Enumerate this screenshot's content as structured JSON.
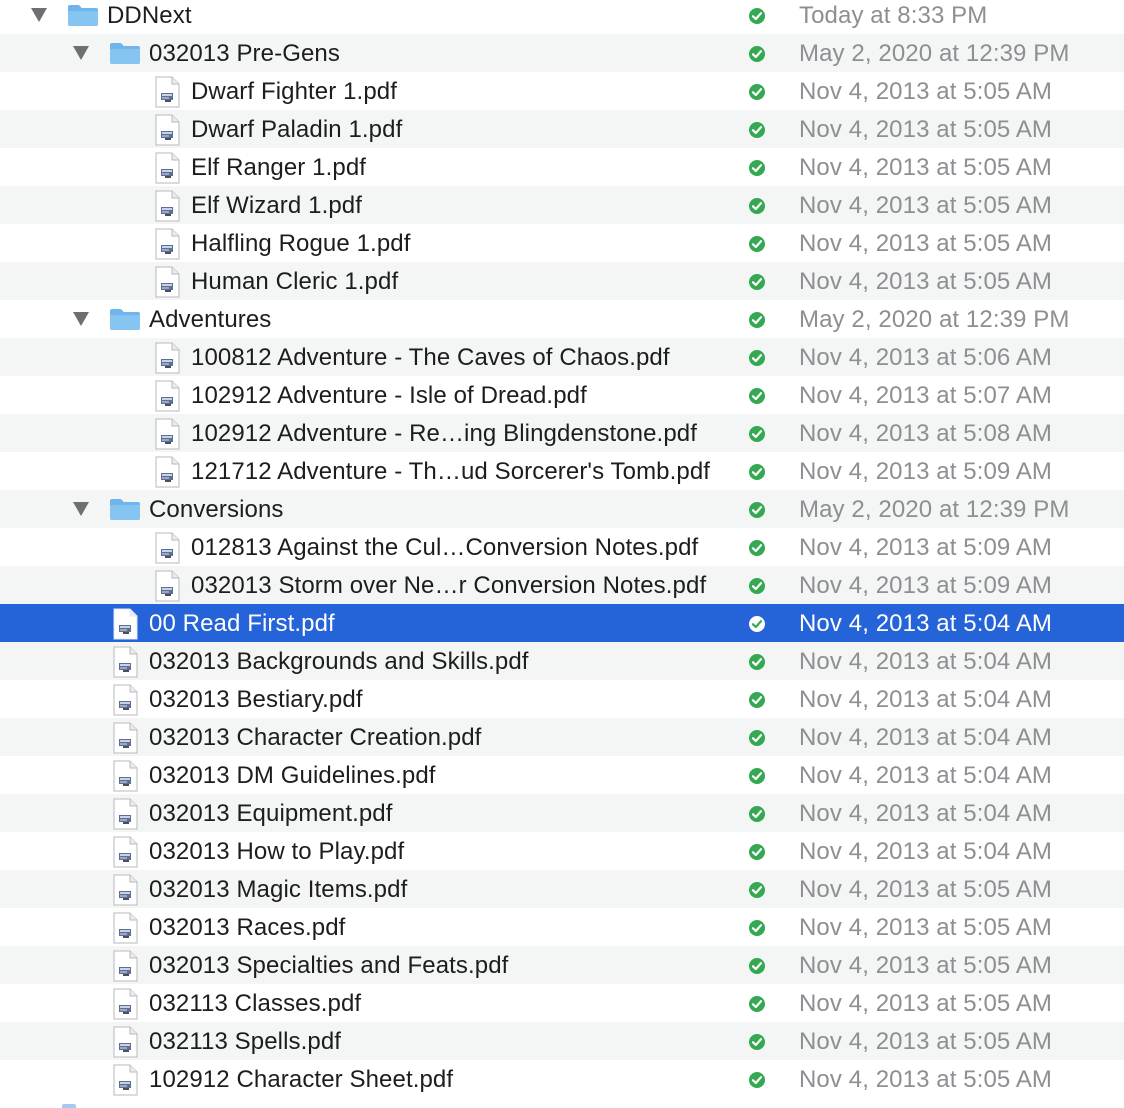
{
  "colors": {
    "selection": "#2563d8",
    "stripe": "#f4f5f5",
    "folder": "#6db5ec",
    "status_ok": "#34a853",
    "date_text": "#8e8e93"
  },
  "rows": [
    {
      "name": "DDNext",
      "date": "Today at 8:33 PM",
      "type": "folder",
      "depth": 0,
      "expanded": true,
      "status": "synced-icon"
    },
    {
      "name": "032013 Pre-Gens",
      "date": "May 2, 2020 at 12:39 PM",
      "type": "folder",
      "depth": 1,
      "expanded": true,
      "status": "synced-icon"
    },
    {
      "name": "Dwarf Fighter 1.pdf",
      "date": "Nov 4, 2013 at 5:05 AM",
      "type": "pdf",
      "depth": 2,
      "status": "synced-icon"
    },
    {
      "name": "Dwarf Paladin 1.pdf",
      "date": "Nov 4, 2013 at 5:05 AM",
      "type": "pdf",
      "depth": 2,
      "status": "synced-icon"
    },
    {
      "name": "Elf Ranger 1.pdf",
      "date": "Nov 4, 2013 at 5:05 AM",
      "type": "pdf",
      "depth": 2,
      "status": "synced-icon"
    },
    {
      "name": "Elf Wizard 1.pdf",
      "date": "Nov 4, 2013 at 5:05 AM",
      "type": "pdf",
      "depth": 2,
      "status": "synced-icon"
    },
    {
      "name": "Halfling Rogue 1.pdf",
      "date": "Nov 4, 2013 at 5:05 AM",
      "type": "pdf",
      "depth": 2,
      "status": "synced-icon"
    },
    {
      "name": "Human Cleric 1.pdf",
      "date": "Nov 4, 2013 at 5:05 AM",
      "type": "pdf",
      "depth": 2,
      "status": "synced-icon"
    },
    {
      "name": "Adventures",
      "date": "May 2, 2020 at 12:39 PM",
      "type": "folder",
      "depth": 1,
      "expanded": true,
      "status": "synced-icon"
    },
    {
      "name": "100812 Adventure - The Caves of Chaos.pdf",
      "date": "Nov 4, 2013 at 5:06 AM",
      "type": "pdf",
      "depth": 2,
      "status": "synced-icon"
    },
    {
      "name": "102912 Adventure - Isle of Dread.pdf",
      "date": "Nov 4, 2013 at 5:07 AM",
      "type": "pdf",
      "depth": 2,
      "status": "synced-icon"
    },
    {
      "name": "102912 Adventure - Re…ing Blingdenstone.pdf",
      "date": "Nov 4, 2013 at 5:08 AM",
      "type": "pdf",
      "depth": 2,
      "status": "synced-icon"
    },
    {
      "name": "121712 Adventure - Th…ud Sorcerer's Tomb.pdf",
      "date": "Nov 4, 2013 at 5:09 AM",
      "type": "pdf",
      "depth": 2,
      "status": "synced-icon"
    },
    {
      "name": "Conversions",
      "date": "May 2, 2020 at 12:39 PM",
      "type": "folder",
      "depth": 1,
      "expanded": true,
      "status": "synced-icon"
    },
    {
      "name": "012813 Against the Cul…Conversion Notes.pdf",
      "date": "Nov 4, 2013 at 5:09 AM",
      "type": "pdf",
      "depth": 2,
      "status": "synced-icon"
    },
    {
      "name": "032013 Storm over Ne…r Conversion Notes.pdf",
      "date": "Nov 4, 2013 at 5:09 AM",
      "type": "pdf",
      "depth": 2,
      "status": "synced-icon"
    },
    {
      "name": "00 Read First.pdf",
      "date": "Nov 4, 2013 at 5:04 AM",
      "type": "pdf",
      "depth": 1,
      "selected": true,
      "status": "synced-icon"
    },
    {
      "name": "032013 Backgrounds and Skills.pdf",
      "date": "Nov 4, 2013 at 5:04 AM",
      "type": "pdf",
      "depth": 1,
      "status": "synced-icon"
    },
    {
      "name": "032013 Bestiary.pdf",
      "date": "Nov 4, 2013 at 5:04 AM",
      "type": "pdf",
      "depth": 1,
      "status": "synced-icon"
    },
    {
      "name": "032013 Character Creation.pdf",
      "date": "Nov 4, 2013 at 5:04 AM",
      "type": "pdf",
      "depth": 1,
      "status": "synced-icon"
    },
    {
      "name": "032013 DM Guidelines.pdf",
      "date": "Nov 4, 2013 at 5:04 AM",
      "type": "pdf",
      "depth": 1,
      "status": "synced-icon"
    },
    {
      "name": "032013 Equipment.pdf",
      "date": "Nov 4, 2013 at 5:04 AM",
      "type": "pdf",
      "depth": 1,
      "status": "synced-icon"
    },
    {
      "name": "032013 How to Play.pdf",
      "date": "Nov 4, 2013 at 5:04 AM",
      "type": "pdf",
      "depth": 1,
      "status": "synced-icon"
    },
    {
      "name": "032013 Magic Items.pdf",
      "date": "Nov 4, 2013 at 5:05 AM",
      "type": "pdf",
      "depth": 1,
      "status": "synced-icon"
    },
    {
      "name": "032013 Races.pdf",
      "date": "Nov 4, 2013 at 5:05 AM",
      "type": "pdf",
      "depth": 1,
      "status": "synced-icon"
    },
    {
      "name": "032013 Specialties and Feats.pdf",
      "date": "Nov 4, 2013 at 5:05 AM",
      "type": "pdf",
      "depth": 1,
      "status": "synced-icon"
    },
    {
      "name": "032113 Classes.pdf",
      "date": "Nov 4, 2013 at 5:05 AM",
      "type": "pdf",
      "depth": 1,
      "status": "synced-icon"
    },
    {
      "name": "032113 Spells.pdf",
      "date": "Nov 4, 2013 at 5:05 AM",
      "type": "pdf",
      "depth": 1,
      "status": "synced-icon"
    },
    {
      "name": "102912 Character Sheet.pdf",
      "date": "Nov 4, 2013 at 5:05 AM",
      "type": "pdf",
      "depth": 1,
      "status": "synced-icon"
    }
  ]
}
